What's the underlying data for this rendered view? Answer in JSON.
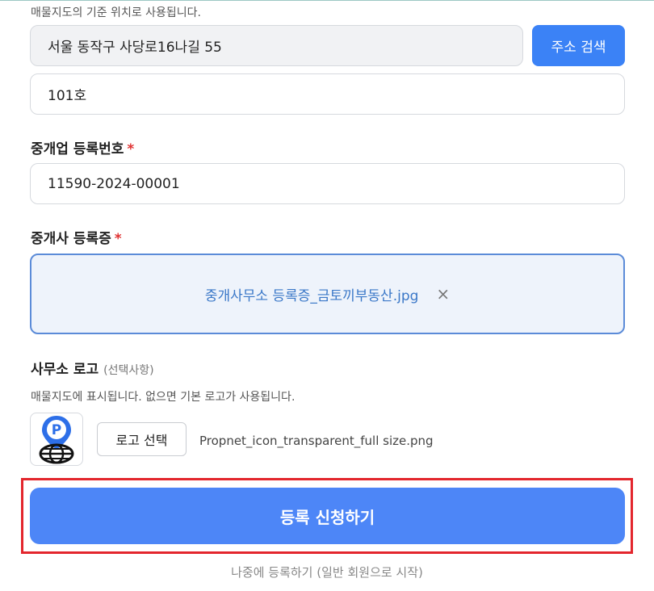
{
  "address": {
    "hint": "매물지도의 기준 위치로 사용됩니다.",
    "main_value": "서울 동작구 사당로16나길 55",
    "search_button": "주소 검색",
    "detail_value": "101호"
  },
  "registration_number": {
    "label": "중개업 등록번호",
    "required_mark": "*",
    "value": "11590-2024-00001"
  },
  "certificate": {
    "label": "중개사 등록증",
    "required_mark": "*",
    "file_name": "중개사무소 등록증_금토끼부동산.jpg",
    "remove_icon": "×"
  },
  "logo": {
    "label": "사무소 로고",
    "optional": "(선택사항)",
    "hint": "매물지도에 표시됩니다. 없으면 기본 로고가 사용됩니다.",
    "select_button": "로고 선택",
    "file_name": "Propnet_icon_transparent_full size.png",
    "thumbnail_letter": "P"
  },
  "submit_button": "등록 신청하기",
  "later_link": "나중에 등록하기 (일반 회원으로 시작)",
  "colors": {
    "primary": "#4d86f7",
    "required": "#e03131",
    "highlight": "#e3262d"
  }
}
